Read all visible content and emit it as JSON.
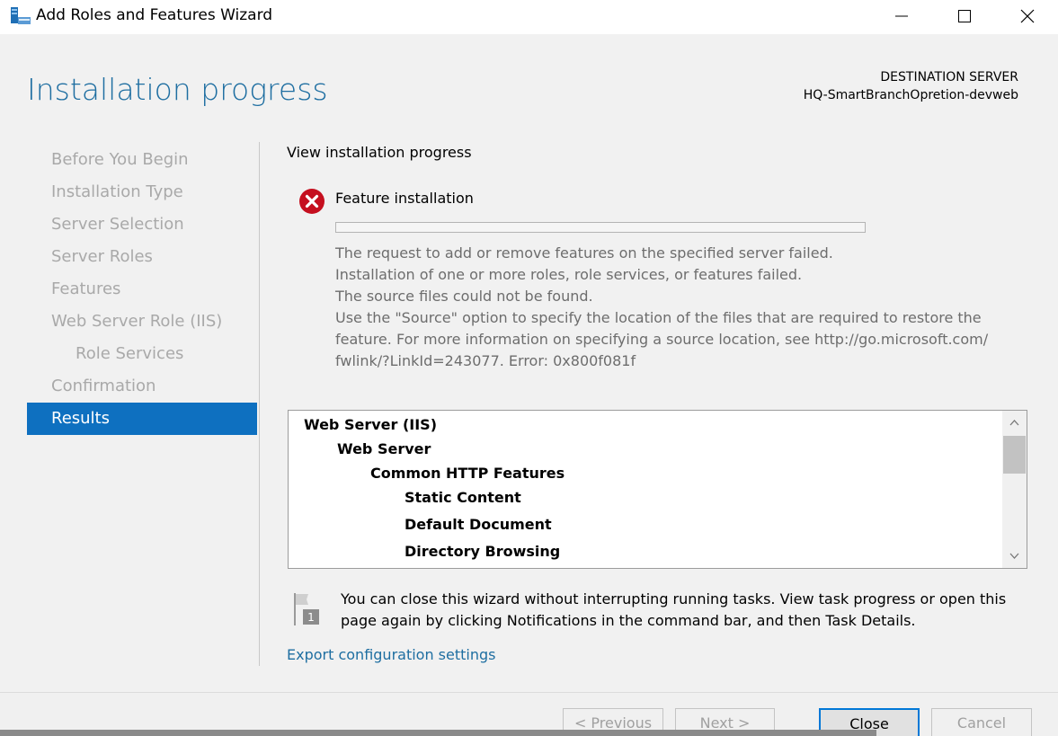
{
  "window": {
    "title": "Add Roles and Features Wizard",
    "minimize_label": "Minimize",
    "maximize_label": "Maximize",
    "close_label": "Close"
  },
  "page": {
    "heading": "Installation progress",
    "destination_label": "DESTINATION SERVER",
    "destination_server": "HQ-SmartBranchOpretion-devweb"
  },
  "nav": {
    "items": [
      {
        "label": "Before You Begin",
        "state": "disabled"
      },
      {
        "label": "Installation Type",
        "state": "disabled"
      },
      {
        "label": "Server Selection",
        "state": "disabled"
      },
      {
        "label": "Server Roles",
        "state": "disabled"
      },
      {
        "label": "Features",
        "state": "disabled"
      },
      {
        "label": "Web Server Role (IIS)",
        "state": "disabled"
      },
      {
        "label": "Role Services",
        "state": "disabled"
      },
      {
        "label": "Confirmation",
        "state": "disabled"
      },
      {
        "label": "Results",
        "state": "active"
      }
    ]
  },
  "content": {
    "view_title": "View installation progress",
    "feature_title": "Feature installation",
    "status_icon": "error-icon",
    "progress_fraction": 0,
    "message_lines": [
      "The request to add or remove features on the specified server failed.",
      "Installation of one or more roles, role services, or features failed.",
      "The source files could not be found.",
      "Use the \"Source\" option to specify the location of the files that are required to restore the",
      "feature. For more information on specifying a source location, see http://go.microsoft.com/",
      "fwlink/?LinkId=243077. Error: 0x800f081f"
    ],
    "tree": [
      {
        "label": "Web Server (IIS)",
        "level": 0
      },
      {
        "label": "Web Server",
        "level": 1
      },
      {
        "label": "Common HTTP Features",
        "level": 2
      },
      {
        "label": "Static Content",
        "level": 3
      },
      {
        "label": "Default Document",
        "level": 3
      },
      {
        "label": "Directory Browsing",
        "level": 3
      }
    ],
    "note": "You can close this wizard without interrupting running tasks. View task progress or open this page again by clicking Notifications in the command bar, and then Task Details.",
    "notification_count": "1",
    "export_link": "Export configuration settings"
  },
  "footer": {
    "previous_label": "< Previous",
    "next_label": "Next >",
    "close_label": "Close",
    "cancel_label": "Cancel"
  },
  "colors": {
    "accent": "#1e6ea1",
    "active_nav": "#0e70c0",
    "error": "#c50f1f",
    "progress_fill": "#06b025"
  }
}
